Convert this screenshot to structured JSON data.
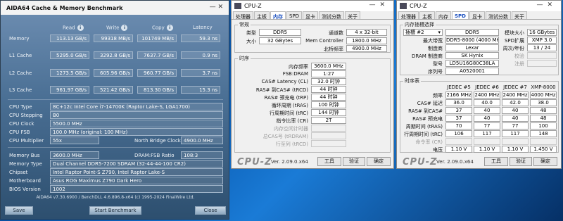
{
  "aida": {
    "title": "AIDA64 Cache & Memory Benchmark",
    "window_controls": "—  ✕",
    "col_read": "Read",
    "col_write": "Write",
    "col_copy": "Copy",
    "col_latency": "Latency",
    "bench_rows": [
      {
        "label": "Memory",
        "read": "113.13 GB/s",
        "write": "99318 MB/s",
        "copy": "101749 MB/s",
        "latency": "59.3 ns"
      },
      {
        "label": "L1 Cache",
        "read": "5295.0 GB/s",
        "write": "3292.8 GB/s",
        "copy": "7637.7 GB/s",
        "latency": "0.9 ns"
      },
      {
        "label": "L2 Cache",
        "read": "1273.5 GB/s",
        "write": "605.96 GB/s",
        "copy": "960.77 GB/s",
        "latency": "3.7 ns"
      },
      {
        "label": "L3 Cache",
        "read": "961.97 GB/s",
        "write": "521.42 GB/s",
        "copy": "813.30 GB/s",
        "latency": "15.3 ns"
      }
    ],
    "cpu_type_label": "CPU Type",
    "cpu_type": "8C+12c Intel Core i7-14700K  (Raptor Lake-S, LGA1700)",
    "cpu_stepping_label": "CPU Stepping",
    "cpu_stepping": "B0",
    "cpu_clock_label": "CPU Clock",
    "cpu_clock": "5500.0 MHz",
    "cpu_fsb_label": "CPU FSB",
    "cpu_fsb": "100.0 MHz  (original: 100 MHz)",
    "cpu_multiplier_label": "CPU Multiplier",
    "cpu_multiplier": "55x",
    "nb_clock_label": "North Bridge Clock",
    "nb_clock": "4900.0 MHz",
    "memory_bus_label": "Memory Bus",
    "memory_bus": "3600.0 MHz",
    "dram_fsb_label": "DRAM:FSB Ratio",
    "dram_fsb": "108:3",
    "memory_type_label": "Memory Type",
    "memory_type": "Dual Channel DDR5-7200 SDRAM  (32-44-44-100 CR2)",
    "chipset_label": "Chipset",
    "chipset": "Intel Raptor Point-S Z790, Intel Raptor Lake-S",
    "motherboard_label": "Motherboard",
    "motherboard": "Asus ROG Maximus Z790 Dark Hero",
    "bios_label": "BIOS Version",
    "bios": "1002",
    "footer": "AIDA64 v7.30.6900 / BenchDLL 4.6.896.8-x64  (c) 1995-2024 FinalWire Ltd.",
    "save": "Save",
    "start": "Start Benchmark",
    "close": "Close"
  },
  "cpuz_mem": {
    "title": "CPU-Z",
    "tabs": [
      "处理器",
      "主板",
      "内存",
      "SPD",
      "显卡",
      "测试分数",
      "关于"
    ],
    "general_title": "常规",
    "type_label": "类型",
    "type": "DDR5",
    "size_label": "大小",
    "size": "32 GBytes",
    "channels_label": "通道数",
    "channels": "4 x 32-bit",
    "memctrl_label": "Mem Controller",
    "memctrl": "1800.0 MHz",
    "nb_label": "北桥频率",
    "nb": "4900.0 MHz",
    "timing_title": "时序",
    "timings": [
      {
        "label": "内存频率",
        "value": "3600.0 MHz"
      },
      {
        "label": "FSB:DRAM",
        "value": "1:27"
      },
      {
        "label": "CAS# Latency (CL)",
        "value": "32.0 时钟"
      },
      {
        "label": "RAS# 到CAS# (tRCD)",
        "value": "44 时钟"
      },
      {
        "label": "RAS# 预充电 (tRP)",
        "value": "44 时钟"
      },
      {
        "label": "循环周期 (tRAS)",
        "value": "100 时钟"
      },
      {
        "label": "行周期时间 (tRC)",
        "value": "144 时钟"
      },
      {
        "label": "指令比率 (CR)",
        "value": "2T"
      },
      {
        "label": "内存空闲计时器",
        "value": ""
      },
      {
        "label": "总CAS号 (tRDRAM)",
        "value": ""
      },
      {
        "label": "行至列 (tRCD)",
        "value": ""
      }
    ],
    "brand": "CPU-Z",
    "version": "Ver. 2.09.0.x64",
    "tools": "工具",
    "validate": "验证",
    "ok": "确定"
  },
  "cpuz_spd": {
    "title": "CPU-Z",
    "tabs": [
      "处理器",
      "主板",
      "内存",
      "SPD",
      "显卡",
      "测试分数",
      "关于"
    ],
    "slot_title": "内存插槽选择",
    "slot": "插槽 #2",
    "mem_type": "DDR5",
    "module_size_label": "模块大小",
    "module_size": "16 GBytes",
    "max_bw_label": "最大带宽",
    "max_bw": "DDR5-8000 (4000 MHz)",
    "spd_ext_label": "SPD扩展",
    "spd_ext": "XMP 3.0",
    "manufacturer_label": "制造商",
    "manufacturer": "Lexar",
    "week_year_label": "周次/年份",
    "week_year": "13 / 24",
    "dram_mfr_label": "DRAM 制造商",
    "dram_mfr": "SK Hynix",
    "buffered_label": "校验",
    "part_label": "型号",
    "part": "LD5U16G80C38LA",
    "registered_label": "注册",
    "serial_label": "序列号",
    "serial": "A0520001",
    "timing_title": "时序表",
    "headers": [
      "JEDEC #5",
      "JEDEC #6",
      "JEDEC #7",
      "XMP-8000"
    ],
    "rows": [
      {
        "label": "频率",
        "values": [
          "2166 MHz",
          "2400 MHz",
          "2400 MHz",
          "4000 MHz"
        ]
      },
      {
        "label": "CAS# 延迟",
        "values": [
          "36.0",
          "40.0",
          "42.0",
          "38.0"
        ]
      },
      {
        "label": "RAS# 到CAS#",
        "values": [
          "37",
          "40",
          "40",
          "48"
        ]
      },
      {
        "label": "RAS# 预充电",
        "values": [
          "37",
          "40",
          "40",
          "48"
        ]
      },
      {
        "label": "周期时间 (tRAS)",
        "values": [
          "70",
          "77",
          "77",
          "100"
        ]
      },
      {
        "label": "行周期时间 (tRC)",
        "values": [
          "106",
          "117",
          "117",
          "148"
        ]
      },
      {
        "label": "命令率 (CR)",
        "values": [
          "",
          "",
          "",
          ""
        ]
      },
      {
        "label": "电压",
        "values": [
          "1.10 V",
          "1.10 V",
          "1.10 V",
          "1.450 V"
        ]
      }
    ],
    "brand": "CPU-Z",
    "version": "Ver. 2.09.0.x64",
    "tools": "工具",
    "validate": "验证",
    "ok": "确定"
  }
}
